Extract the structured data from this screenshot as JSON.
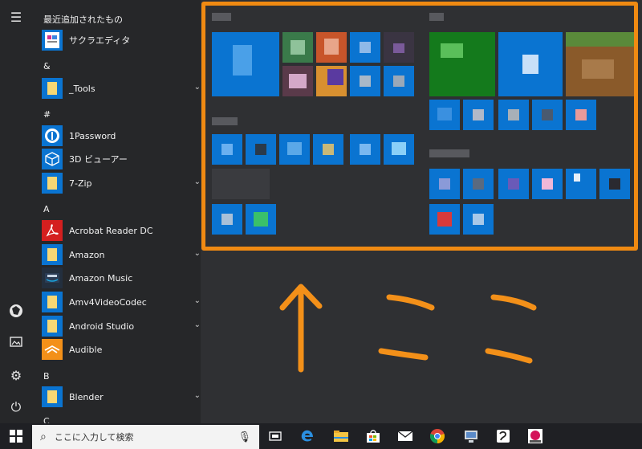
{
  "start_menu": {
    "recent_header": "最近追加されたもの",
    "items": [
      {
        "label": "サクラエディタ",
        "icon": "sakura-editor-icon",
        "color": "#ffffff",
        "chevron": false
      },
      {
        "label": "&",
        "type": "header"
      },
      {
        "label": "_Tools",
        "icon": "folder-icon",
        "color": "#0a74d1",
        "chevron": true
      },
      {
        "label": "#",
        "type": "header"
      },
      {
        "label": "1Password",
        "icon": "1password-icon",
        "color": "#0a74d1",
        "chevron": false
      },
      {
        "label": "3D ビューアー",
        "icon": "3d-viewer-icon",
        "color": "#0a74d1",
        "chevron": false
      },
      {
        "label": "7-Zip",
        "icon": "folder-icon",
        "color": "#0a74d1",
        "chevron": true
      },
      {
        "label": "A",
        "type": "header"
      },
      {
        "label": "Acrobat Reader DC",
        "icon": "acrobat-icon",
        "color": "#d41f1f",
        "chevron": false
      },
      {
        "label": "Amazon",
        "icon": "folder-icon",
        "color": "#0a74d1",
        "chevron": true
      },
      {
        "label": "Amazon Music",
        "icon": "amazon-music-icon",
        "color": "#232f3e",
        "chevron": false
      },
      {
        "label": "Amv4VideoCodec",
        "icon": "folder-icon",
        "color": "#0a74d1",
        "chevron": true
      },
      {
        "label": "Android Studio",
        "icon": "folder-icon",
        "color": "#0a74d1",
        "chevron": true
      },
      {
        "label": "Audible",
        "icon": "audible-icon",
        "color": "#f39019",
        "chevron": false
      },
      {
        "label": "B",
        "type": "header"
      },
      {
        "label": "Blender",
        "icon": "folder-icon",
        "color": "#0a74d1",
        "chevron": true
      },
      {
        "label": "C",
        "type": "header"
      }
    ]
  },
  "taskbar": {
    "search_placeholder": "ここに入力して検索"
  },
  "colors": {
    "accent": "#0a74d1",
    "highlight_orange": "#f08a12",
    "bg": "#2f3033"
  }
}
